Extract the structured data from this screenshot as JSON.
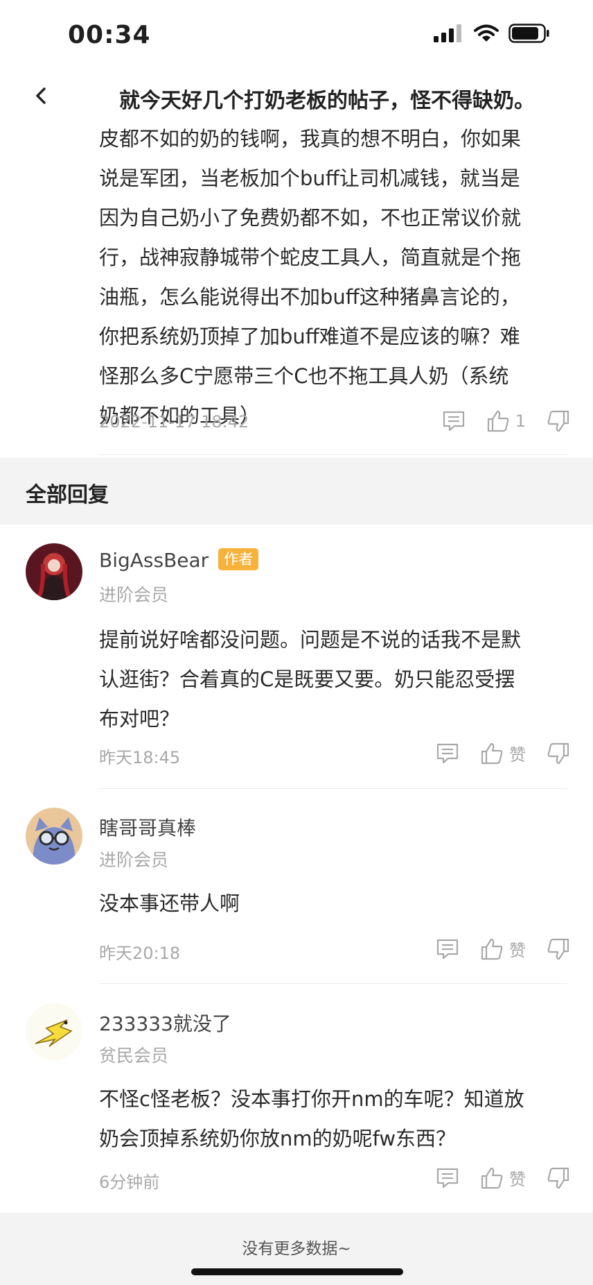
{
  "status": {
    "time": "00:34"
  },
  "nav": {
    "title": "就今天好几个打奶老板的帖子，怪不得缺奶。"
  },
  "post": {
    "lines": [
      "皮都不如的奶的钱啊，我真的想不明白，你如果",
      "说是军团，当老板加个buff让司机减钱，就当是",
      "因为自己奶小了免费奶都不如，不也正常议价就",
      "行，战神寂静城带个蛇皮工具人，简直就是个拖",
      "油瓶，怎么能说得出不加buff这种猪鼻言论的，",
      "你把系统奶顶掉了加buff难道不是应该的嘛？难",
      "怪那么多C宁愿带三个C也不拖工具人奶（系统",
      "奶都不如的工具）"
    ],
    "time": "2022-11-17 18:42",
    "like_count": "1"
  },
  "section": {
    "title": "全部回复"
  },
  "comments": [
    {
      "username": "BigAssBear",
      "badge": "作者",
      "level": "进阶会员",
      "lines": [
        "提前说好啥都没问题。问题是不说的话我不是默",
        "认逛街？合着真的C是既要又要。奶只能忍受摆",
        "布对吧？"
      ],
      "time": "昨天18:45",
      "like_label": "赞"
    },
    {
      "username": "瞎哥哥真棒",
      "level": "进阶会员",
      "lines": [
        "没本事还带人啊"
      ],
      "time": "昨天20:18",
      "like_label": "赞"
    },
    {
      "username": "233333就没了",
      "level": "贫民会员",
      "lines": [
        "不怪c怪老板？没本事打你开nm的车呢？知道放",
        "奶会顶掉系统奶你放nm的奶呢fw东西？"
      ],
      "time": "6分钟前",
      "like_label": "赞"
    }
  ],
  "footer": {
    "text": "没有更多数据~"
  }
}
